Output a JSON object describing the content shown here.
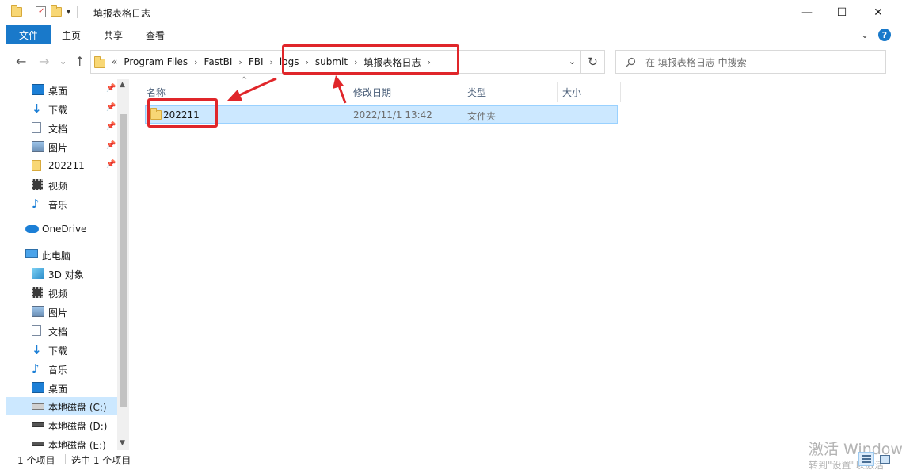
{
  "window": {
    "title": "填报表格日志",
    "minimize": "—",
    "maximize": "☐",
    "close": "✕"
  },
  "ribbon": {
    "tabs": [
      "文件",
      "主页",
      "共享",
      "查看"
    ],
    "help": "?",
    "expand": "⌄"
  },
  "address": {
    "overflow": "«",
    "crumbs": [
      "Program Files",
      "FastBI",
      "FBI",
      "logs",
      "submit",
      "填报表格日志"
    ],
    "dropdown": "⌄",
    "refresh": "↻"
  },
  "nav_buttons": {
    "back": "←",
    "forward": "→",
    "recent": "⌄",
    "up": "↑"
  },
  "search": {
    "placeholder": "在 填报表格日志 中搜索",
    "icon": "search-icon"
  },
  "nav_pane": {
    "items": [
      {
        "label": "桌面",
        "icon": "desktop-icon",
        "pinned": true
      },
      {
        "label": "下载",
        "icon": "download-icon",
        "pinned": true
      },
      {
        "label": "文档",
        "icon": "document-icon",
        "pinned": true
      },
      {
        "label": "图片",
        "icon": "picture-icon",
        "pinned": true
      },
      {
        "label": "202211",
        "icon": "folder-icon",
        "pinned": true
      },
      {
        "label": "视频",
        "icon": "video-icon",
        "pinned": false
      },
      {
        "label": "音乐",
        "icon": "music-icon",
        "pinned": false
      },
      {
        "label": "OneDrive",
        "icon": "onedrive-icon",
        "pinned": false
      },
      {
        "label": "此电脑",
        "icon": "pc-icon",
        "pinned": false
      },
      {
        "label": "3D 对象",
        "icon": "3d-objects-icon",
        "pinned": false
      },
      {
        "label": "视频",
        "icon": "video-icon",
        "pinned": false
      },
      {
        "label": "图片",
        "icon": "picture-icon",
        "pinned": false
      },
      {
        "label": "文档",
        "icon": "document-icon",
        "pinned": false
      },
      {
        "label": "下载",
        "icon": "download-icon",
        "pinned": false
      },
      {
        "label": "音乐",
        "icon": "music-icon",
        "pinned": false
      },
      {
        "label": "桌面",
        "icon": "desktop-icon",
        "pinned": false
      },
      {
        "label": "本地磁盘 (C:)",
        "icon": "drive-c-icon",
        "pinned": false,
        "selected": true
      },
      {
        "label": "本地磁盘 (D:)",
        "icon": "drive-icon",
        "pinned": false
      },
      {
        "label": "本地磁盘 (E:)",
        "icon": "drive-icon",
        "pinned": false
      }
    ]
  },
  "columns": {
    "name": "名称",
    "modified": "修改日期",
    "type": "类型",
    "size": "大小"
  },
  "files": [
    {
      "name": "202211",
      "modified": "2022/11/1 13:42",
      "type": "文件夹",
      "size": ""
    }
  ],
  "status": {
    "count": "1 个项目",
    "selected": "选中 1 个项目"
  },
  "watermark": {
    "line1": "激活 Windows",
    "line2": "转到\"设置\"以激活"
  },
  "colors": {
    "accent": "#1979ca",
    "selection": "#cce8ff",
    "annotation": "#e0262a"
  }
}
